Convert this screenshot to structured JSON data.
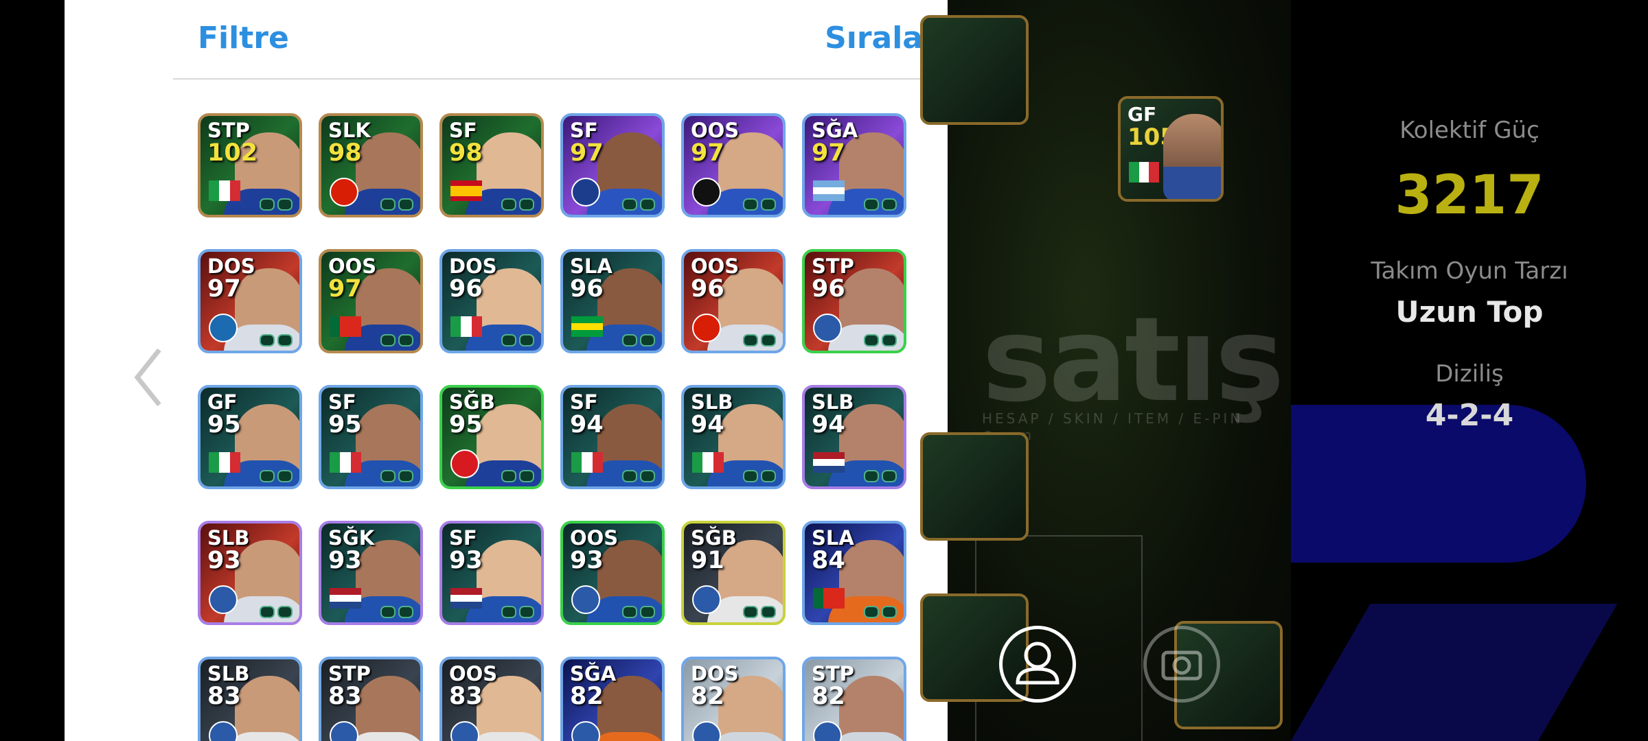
{
  "modal": {
    "filter_label": "Filtre",
    "sort_label": "Sırala"
  },
  "info_panel": {
    "collective_label": "Kolektif Güç",
    "collective_value": "3217",
    "style_label": "Takım Oyun Tarzı",
    "style_value": "Uzun Top",
    "formation_label": "Diziliş",
    "formation_value": "4-2-4",
    "accent_color": "#b9b012"
  },
  "field_cards": [
    {
      "position": "GF",
      "rating": "105"
    }
  ],
  "players": [
    {
      "position": "STP",
      "rating": "102",
      "rating_color": "gold",
      "frame": "gold",
      "bg": "green",
      "emblem": "flag-italy"
    },
    {
      "position": "SLK",
      "rating": "98",
      "rating_color": "gold",
      "frame": "gold",
      "bg": "green",
      "emblem": "manutd-badge"
    },
    {
      "position": "SF",
      "rating": "98",
      "rating_color": "gold",
      "frame": "gold",
      "bg": "green",
      "emblem": "flag-spain"
    },
    {
      "position": "SF",
      "rating": "97",
      "rating_color": "gold",
      "frame": "blue",
      "bg": "purple",
      "emblem": "fenerbahce-badge"
    },
    {
      "position": "OOS",
      "rating": "97",
      "rating_color": "gold",
      "frame": "blue",
      "bg": "purple",
      "emblem": "besiktas-badge"
    },
    {
      "position": "SĞA",
      "rating": "97",
      "rating_color": "gold",
      "frame": "blue",
      "bg": "purple",
      "emblem": "flag-argentina"
    },
    {
      "position": "DOS",
      "rating": "97",
      "rating_color": "white",
      "frame": "blue",
      "bg": "red",
      "emblem": "city-badge"
    },
    {
      "position": "OOS",
      "rating": "97",
      "rating_color": "gold",
      "frame": "gold",
      "bg": "green",
      "emblem": "flag-portugal"
    },
    {
      "position": "DOS",
      "rating": "96",
      "rating_color": "white",
      "frame": "blue",
      "bg": "teal",
      "emblem": "flag-italy"
    },
    {
      "position": "SLA",
      "rating": "96",
      "rating_color": "white",
      "frame": "blue",
      "bg": "teal",
      "emblem": "flag-brazil"
    },
    {
      "position": "OOS",
      "rating": "96",
      "rating_color": "white",
      "frame": "blue",
      "bg": "red",
      "emblem": "manutd-badge"
    },
    {
      "position": "STP",
      "rating": "96",
      "rating_color": "white",
      "frame": "green",
      "bg": "red",
      "emblem": "club-badge"
    },
    {
      "position": "GF",
      "rating": "95",
      "rating_color": "white",
      "frame": "blue",
      "bg": "teal",
      "emblem": "flag-italy"
    },
    {
      "position": "SF",
      "rating": "95",
      "rating_color": "white",
      "frame": "blue",
      "bg": "teal",
      "emblem": "flag-italy"
    },
    {
      "position": "SĞB",
      "rating": "95",
      "rating_color": "white",
      "frame": "green",
      "bg": "green",
      "emblem": "arsenal-badge"
    },
    {
      "position": "SF",
      "rating": "94",
      "rating_color": "white",
      "frame": "blue",
      "bg": "teal",
      "emblem": "flag-italy"
    },
    {
      "position": "SLB",
      "rating": "94",
      "rating_color": "white",
      "frame": "blue",
      "bg": "teal",
      "emblem": "flag-italy"
    },
    {
      "position": "SLB",
      "rating": "94",
      "rating_color": "white",
      "frame": "purple",
      "bg": "teal",
      "emblem": "flag-netherlands"
    },
    {
      "position": "SLB",
      "rating": "93",
      "rating_color": "white",
      "frame": "purple",
      "bg": "red",
      "emblem": "club-badge"
    },
    {
      "position": "SĞK",
      "rating": "93",
      "rating_color": "white",
      "frame": "purple",
      "bg": "teal",
      "emblem": "flag-netherlands"
    },
    {
      "position": "SF",
      "rating": "93",
      "rating_color": "white",
      "frame": "purple",
      "bg": "teal",
      "emblem": "flag-netherlands"
    },
    {
      "position": "OOS",
      "rating": "93",
      "rating_color": "white",
      "frame": "green",
      "bg": "teal",
      "emblem": "club-badge"
    },
    {
      "position": "SĞB",
      "rating": "91",
      "rating_color": "white",
      "frame": "yellow",
      "bg": "dark",
      "emblem": "club-badge"
    },
    {
      "position": "SLA",
      "rating": "84",
      "rating_color": "white",
      "frame": "blue",
      "bg": "navy",
      "emblem": "flag-portugal"
    },
    {
      "position": "SLB",
      "rating": "83",
      "rating_color": "white",
      "frame": "blue",
      "bg": "dark",
      "emblem": "club-badge"
    },
    {
      "position": "STP",
      "rating": "83",
      "rating_color": "white",
      "frame": "blue",
      "bg": "dark",
      "emblem": "club-badge"
    },
    {
      "position": "OOS",
      "rating": "83",
      "rating_color": "white",
      "frame": "blue",
      "bg": "dark",
      "emblem": "club-badge"
    },
    {
      "position": "SĞA",
      "rating": "82",
      "rating_color": "white",
      "frame": "blue",
      "bg": "navy",
      "emblem": "club-badge"
    },
    {
      "position": "DOS",
      "rating": "82",
      "rating_color": "white",
      "frame": "blue",
      "bg": "light",
      "emblem": "club-badge"
    },
    {
      "position": "STP",
      "rating": "82",
      "rating_color": "white",
      "frame": "blue",
      "bg": "light",
      "emblem": "club-badge"
    }
  ]
}
